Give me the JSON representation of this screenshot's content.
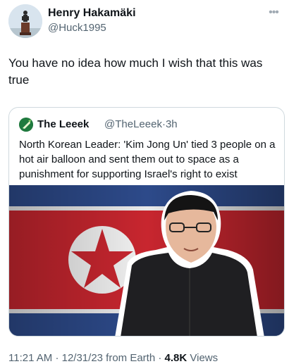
{
  "author": {
    "display_name": "Henry Hakamäki",
    "handle": "@Huck1995",
    "avatar_icon": "statue-avatar"
  },
  "tweet": {
    "text": "You have no idea how much I wish that this was true"
  },
  "more_icon": "more-horizontal-icon",
  "quote": {
    "display_name": "The Leeek",
    "handle": "@TheLeeek",
    "separator": "·",
    "time": "3h",
    "text": "North Korean Leader: 'Kim Jong Un' tied 3 people on a hot air balloon and sent them out to space as a punishment for supporting Israel's right to exist",
    "media": {
      "flag_colors": [
        "#2d4a8a",
        "#ffffff",
        "#c8262f"
      ]
    }
  },
  "footer": {
    "time": "11:21 AM",
    "dot1": "·",
    "date": "12/31/23 from Earth",
    "dot2": "·",
    "views_count": "4.8K",
    "views_label": "Views"
  }
}
